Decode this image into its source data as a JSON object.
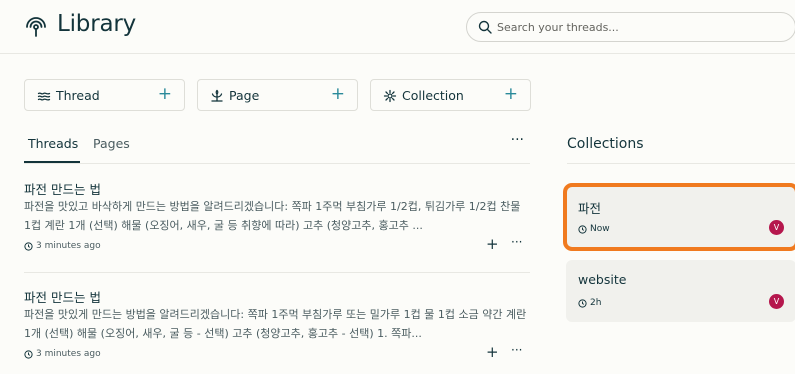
{
  "header": {
    "title": "Library",
    "search_placeholder": "Search your threads..."
  },
  "create_cards": [
    {
      "label": "Thread",
      "icon": "thread-icon"
    },
    {
      "label": "Page",
      "icon": "page-icon"
    },
    {
      "label": "Collection",
      "icon": "collection-icon"
    }
  ],
  "tabs": [
    {
      "label": "Threads",
      "active": true
    },
    {
      "label": "Pages",
      "active": false
    }
  ],
  "threads": [
    {
      "title": "파전 만드는 법",
      "text": "파전을 맛있고 바삭하게 만드는 방법을 알려드리겠습니다: 쪽파 1주먹 부침가루 1/2컵, 튀김가루 1/2컵 찬물 1컵 계란 1개 (선택) 해물 (오징어, 새우, 굴 등 취향에 따라) 고추 (청양고추, 홍고추 ...",
      "time": "3 minutes ago"
    },
    {
      "title": "파전 만드는 법",
      "text": "파전을 맛있게 만드는 방법을 알려드리겠습니다: 쪽파 1주먹 부침가루 또는 밀가루 1컵 물 1컵 소금 약간 계란 1개 (선택) 해물 (오징어, 새우, 굴 등 - 선택) 고추 (청양고추, 홍고추 - 선택) 1. 쪽파...",
      "time": "3 minutes ago"
    }
  ],
  "collections": {
    "title": "Collections",
    "items": [
      {
        "name": "파전",
        "time": "Now",
        "avatar": "V",
        "highlighted": true
      },
      {
        "name": "website",
        "time": "2h",
        "avatar": "V",
        "highlighted": false
      }
    ]
  },
  "colors": {
    "accent": "#2a8a9a",
    "text": "#13343b",
    "highlight": "#f07a1f",
    "avatar": "#b5174d"
  }
}
